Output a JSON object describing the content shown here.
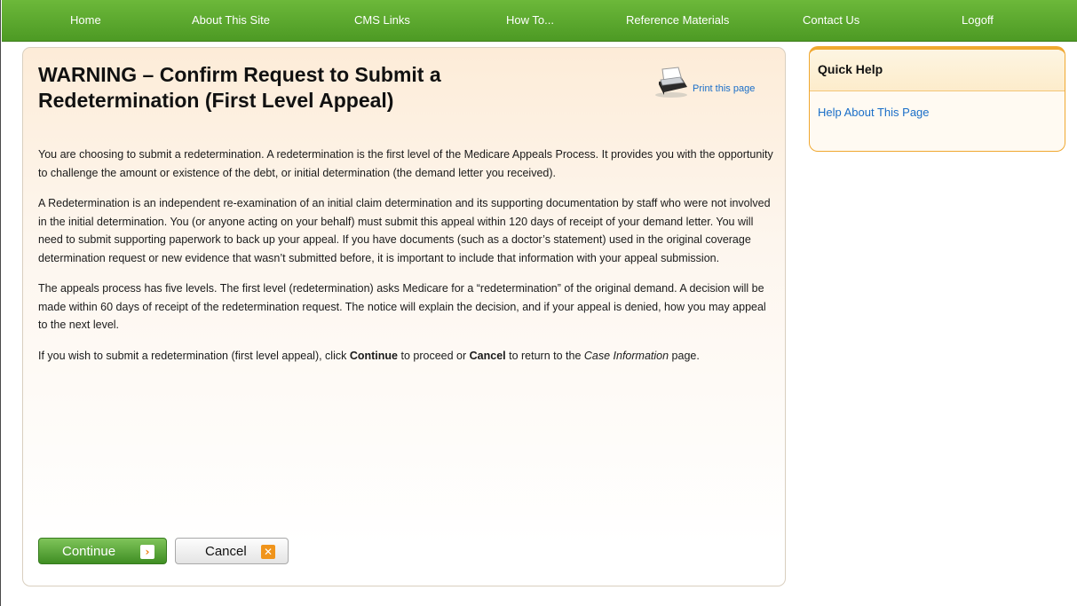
{
  "nav": {
    "items": [
      "Home",
      "About This Site",
      "CMS Links",
      "How To...",
      "Reference Materials",
      "Contact Us",
      "Logoff"
    ]
  },
  "main": {
    "title": "WARNING – Confirm Request to Submit a Redetermination (First Level Appeal)",
    "print_label": "Print this page",
    "paragraphs": [
      "You are choosing to submit a redetermination. A redetermination is the first level of the Medicare Appeals Process. It provides you with the opportunity to challenge the amount or existence of the debt, or initial determination (the demand letter you received).",
      "A Redetermination is an independent re-examination of an initial claim determination and its supporting documentation by staff who were not involved in the initial determination. You (or anyone acting on your behalf) must submit this appeal within 120 days of receipt of your demand letter. You will need to submit supporting paperwork to back up your appeal. If you have documents (such as a doctor’s statement) used in the original coverage determination request or new evidence that wasn’t submitted before, it is important to include that information with your appeal submission.",
      "The appeals process has five levels. The first level (redetermination) asks Medicare for a “redetermination” of the original demand. A decision will be made within 60 days of receipt of the redetermination request. The notice will explain the decision, and if your appeal is denied, how you may appeal to the next level."
    ],
    "last_paragraph": {
      "part1": "If you wish to submit a redetermination (first level appeal), click ",
      "continue_word": "Continue",
      "part2": " to proceed or ",
      "cancel_word": "Cancel",
      "part3": " to return to the ",
      "page_name": "Case Information",
      "part4": " page."
    },
    "continue_label": "Continue",
    "cancel_label": "Cancel"
  },
  "quick_help": {
    "title": "Quick Help",
    "link": "Help About This Page"
  },
  "colors": {
    "nav_green": "#5aa82e",
    "link_blue": "#1a6ec8",
    "accent_orange": "#f0a830"
  }
}
